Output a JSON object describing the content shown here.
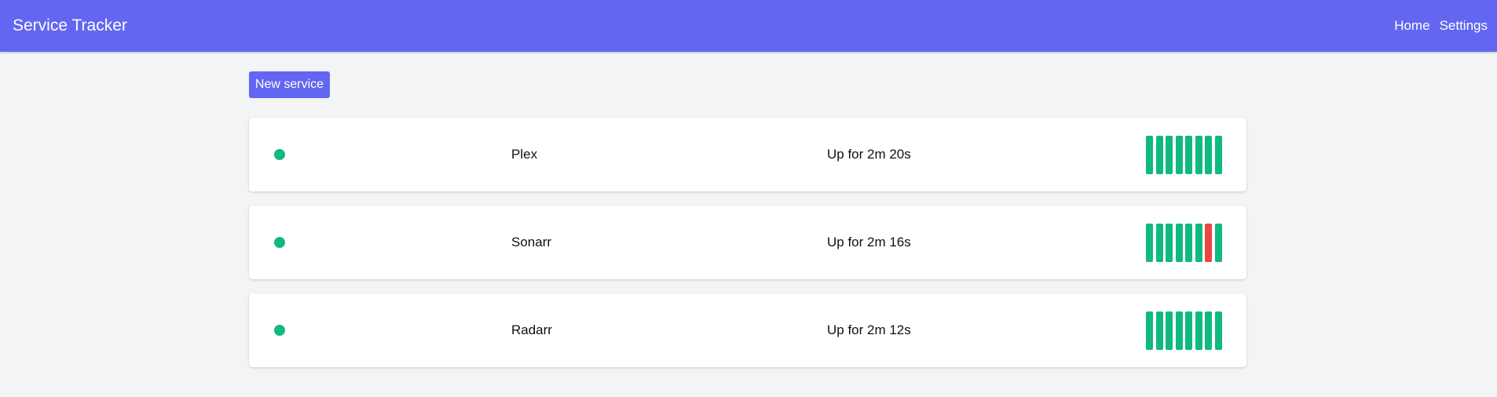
{
  "header": {
    "title": "Service Tracker",
    "nav": [
      {
        "label": "Home"
      },
      {
        "label": "Settings"
      }
    ]
  },
  "toolbar": {
    "new_service_label": "New service"
  },
  "colors": {
    "brand": "#6366f1",
    "up": "#10b981",
    "down": "#ef4444"
  },
  "services": [
    {
      "name": "Plex",
      "status": "up",
      "uptime": "Up for 2m 20s",
      "history": [
        "up",
        "up",
        "up",
        "up",
        "up",
        "up",
        "up",
        "up"
      ]
    },
    {
      "name": "Sonarr",
      "status": "up",
      "uptime": "Up for 2m 16s",
      "history": [
        "up",
        "up",
        "up",
        "up",
        "up",
        "up",
        "down",
        "up"
      ]
    },
    {
      "name": "Radarr",
      "status": "up",
      "uptime": "Up for 2m 12s",
      "history": [
        "up",
        "up",
        "up",
        "up",
        "up",
        "up",
        "up",
        "up"
      ]
    }
  ]
}
